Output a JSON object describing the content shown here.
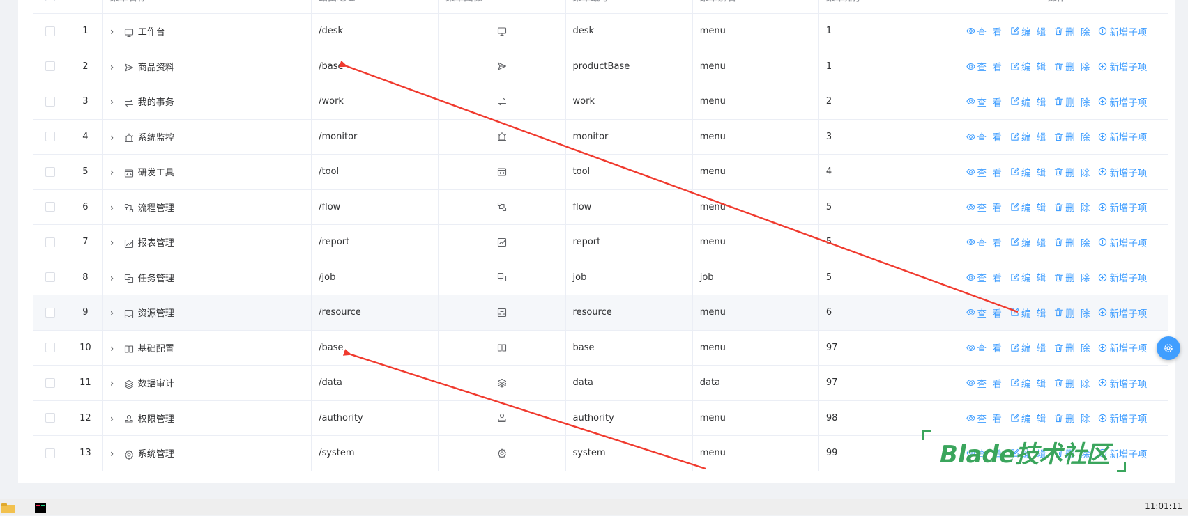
{
  "table": {
    "headers": {
      "index": "#",
      "name": "菜单名称",
      "path": "路由地址",
      "icon": "菜单图标",
      "code": "菜单编号",
      "alias": "菜单别名",
      "sort": "菜单排序",
      "actions": "操作"
    },
    "actions": {
      "view": "查 看",
      "edit": "编 辑",
      "delete": "删 除",
      "add_child": "新增子项"
    },
    "rows": [
      {
        "index": "1",
        "name": "工作台",
        "path": "/desk",
        "code": "desk",
        "alias": "menu",
        "sort": "1",
        "icon": "monitor-icon"
      },
      {
        "index": "2",
        "name": "商品资料",
        "path": "/base",
        "code": "productBase",
        "alias": "menu",
        "sort": "1",
        "icon": "send-icon"
      },
      {
        "index": "3",
        "name": "我的事务",
        "path": "/work",
        "code": "work",
        "alias": "menu",
        "sort": "2",
        "icon": "switch-icon"
      },
      {
        "index": "4",
        "name": "系统监控",
        "path": "/monitor",
        "code": "monitor",
        "alias": "menu",
        "sort": "3",
        "icon": "alarm-icon"
      },
      {
        "index": "5",
        "name": "研发工具",
        "path": "/tool",
        "code": "tool",
        "alias": "menu",
        "sort": "4",
        "icon": "code-window-icon"
      },
      {
        "index": "6",
        "name": "流程管理",
        "path": "/flow",
        "code": "flow",
        "alias": "menu",
        "sort": "5",
        "icon": "flow-icon"
      },
      {
        "index": "7",
        "name": "报表管理",
        "path": "/report",
        "code": "report",
        "alias": "menu",
        "sort": "5",
        "icon": "chart-icon"
      },
      {
        "index": "8",
        "name": "任务管理",
        "path": "/job",
        "code": "job",
        "alias": "job",
        "sort": "5",
        "icon": "copy-icon"
      },
      {
        "index": "9",
        "name": "资源管理",
        "path": "/resource",
        "code": "resource",
        "alias": "menu",
        "sort": "6",
        "icon": "inbox-icon"
      },
      {
        "index": "10",
        "name": "基础配置",
        "path": "/base",
        "code": "base",
        "alias": "menu",
        "sort": "97",
        "icon": "book-icon"
      },
      {
        "index": "11",
        "name": "数据审计",
        "path": "/data",
        "code": "data",
        "alias": "data",
        "sort": "97",
        "icon": "layers-icon"
      },
      {
        "index": "12",
        "name": "权限管理",
        "path": "/authority",
        "code": "authority",
        "alias": "menu",
        "sort": "98",
        "icon": "stamp-icon"
      },
      {
        "index": "13",
        "name": "系统管理",
        "path": "/system",
        "code": "system",
        "alias": "menu",
        "sort": "99",
        "icon": "settings-icon"
      }
    ]
  },
  "watermark": "Blade技术社区",
  "taskbar": {
    "clock": "11:01:11"
  },
  "colors": {
    "primary": "#409eff",
    "annotation": "#f03a2e",
    "watermark": "#3aa55c"
  }
}
